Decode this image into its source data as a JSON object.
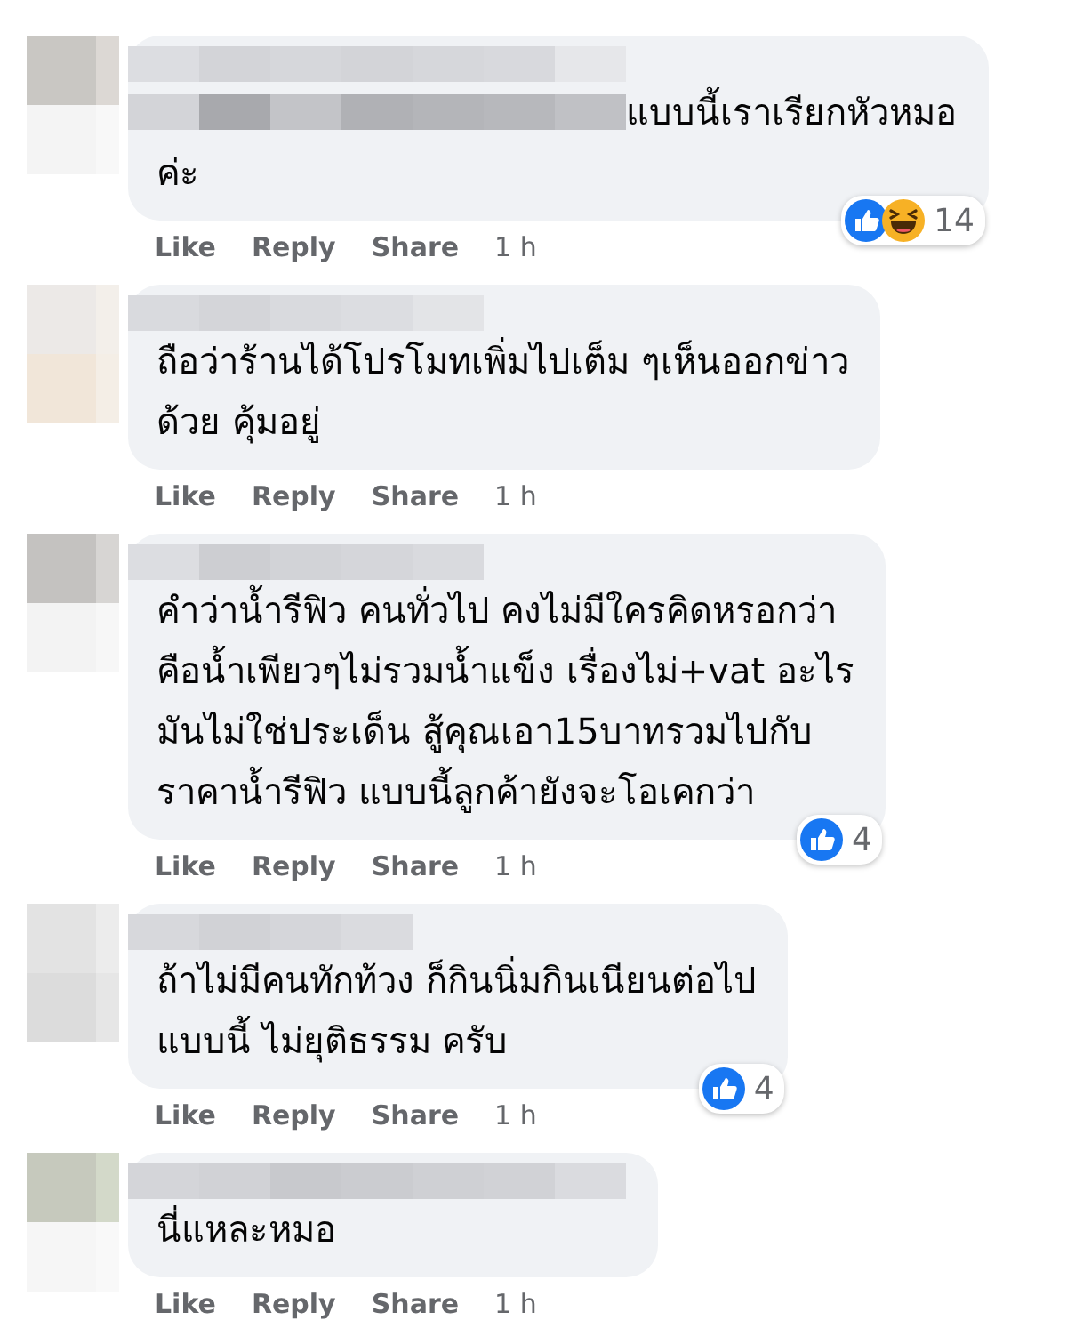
{
  "comments": [
    {
      "text": "แบบนี้เราเรียกหัวหมอ\nค่ะ",
      "actions": [
        "Like",
        "Reply",
        "Share"
      ],
      "time": "1 h",
      "reactions": {
        "icons": [
          {
            "kind": "like"
          },
          {
            "kind": "haha"
          }
        ],
        "count": "14"
      }
    },
    {
      "text": "ถือว่าร้านได้โปรโมทเพิ่มไปเต็ม ๆเห็นออกข่าว\nด้วย คุ้มอยู่",
      "actions": [
        "Like",
        "Reply",
        "Share"
      ],
      "time": "1 h"
    },
    {
      "text": "คำว่าน้ำรีฟิว คนทั่วไป คงไม่มีใครคิดหรอกว่า\nคือน้ำเพียวๆไม่รวมน้ำแข็ง เรื่องไม่+vat อะไร\nมันไม่ใช่ประเด็น สู้คุณเอา15บาทรวมไปกับ\nราคาน้ำรีฟิว แบบนี้ลูกค้ายังจะโอเคกว่า",
      "actions": [
        "Like",
        "Reply",
        "Share"
      ],
      "time": "1 h",
      "reactions": {
        "icons": [
          {
            "kind": "like"
          }
        ],
        "count": "4"
      }
    },
    {
      "text": "ถ้าไม่มีคนทักท้วง ก็กินนิ่มกินเนียนต่อไป\nแบบนี้ ไม่ยุติธรรม ครับ",
      "actions": [
        "Like",
        "Reply",
        "Share"
      ],
      "time": "1 h",
      "reactions": {
        "icons": [
          {
            "kind": "like"
          }
        ],
        "count": "4"
      }
    },
    {
      "text": "นี่แหละหมอ",
      "actions": [
        "Like",
        "Reply",
        "Share"
      ],
      "time": "1 h"
    }
  ]
}
